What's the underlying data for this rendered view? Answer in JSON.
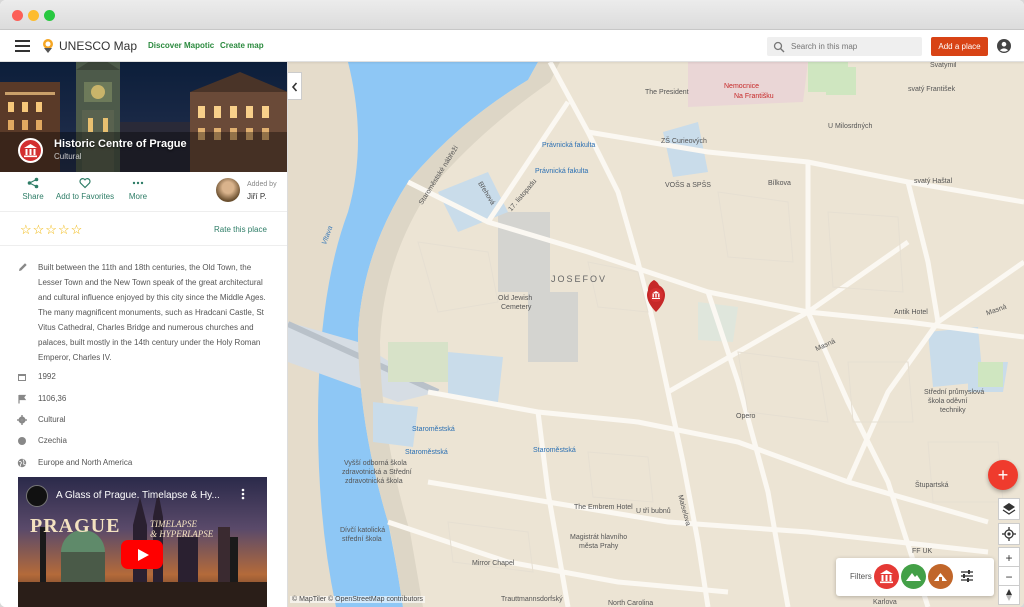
{
  "app": {
    "title": "UNESCO Map",
    "nav": [
      "Discover Mapotic",
      "Create map"
    ],
    "search_placeholder": "Search in this map",
    "add_place": "Add a place"
  },
  "place": {
    "name": "Historic Centre of Prague",
    "category": "Cultural",
    "actions": {
      "share": "Share",
      "favorite": "Add to Favorites",
      "more": "More"
    },
    "added_by_label": "Added by",
    "added_by_name": "Jiří P.",
    "rate_label": "Rate this place",
    "stars": "☆☆☆☆☆",
    "description": "Built between the 11th and 18th centuries, the Old Town, the Lesser Town and the New Town speak of the great architectural and cultural influence enjoyed by this city since the Middle Ages. The many magnificent monuments, such as Hradcani Castle, St Vitus Cathedral, Charles Bridge and numerous churches and palaces, built mostly in the 14th century under the Holy Roman Emperor, Charles IV.",
    "info": [
      {
        "icon": "calendar-icon",
        "value": "1992"
      },
      {
        "icon": "flag-icon",
        "value": "1106,36"
      },
      {
        "icon": "gear-icon",
        "value": "Cultural"
      },
      {
        "icon": "circle-icon",
        "value": "Czechia"
      },
      {
        "icon": "globe-icon",
        "value": "Europe and North America"
      }
    ],
    "video": {
      "title": "A Glass of Prague. Timelapse & Hy...",
      "thumb_title": "PRAGUE",
      "thumb_subtitle_1": "TIMELAPSE",
      "thumb_subtitle_2": "& HYPERLAPSE"
    }
  },
  "map": {
    "labels": {
      "josefov": "JOSEFOV",
      "vltava": "Vltava",
      "president": "The President",
      "nemocnice_1": "Nemocnice",
      "nemocnice_2": "Na Františku",
      "svatymil": "Svatymil",
      "frantisek": "svatý František",
      "milosrdnych": "U Milosrdných",
      "pravnicka_1": "Právnická fakulta",
      "pravnicka_2": "Právnická fakulta",
      "zs": "ZŠ Curieových",
      "voss": "VOŠS a SPŠS",
      "bilkova": "Bílkova",
      "svaty_hastal": "svatý Haštal",
      "brehova": "Břehová",
      "listopadu": "17. listopadu",
      "nabrezi": "Staroměstské nábřeží",
      "cemetery_1": "Old Jewish",
      "cemetery_2": "Cemetery",
      "antik": "Antik Hotel",
      "masna_1": "Masná",
      "masna_2": "Masná",
      "stredni_1": "Střední průmyslová",
      "stredni_2": "škola oděvní",
      "stredni_3": "techniky",
      "opero": "Opero",
      "staromestska_1": "Staroměstská",
      "staromestska_2": "Staroměstská",
      "staromestska_3": "Staroměstská",
      "vyssi_1": "Vyšší odborná škola",
      "vyssi_2": "zdravotnická a Střední",
      "vyssi_3": "zdravotnická škola",
      "embrem": "The Embrem Hotel",
      "utri": "U tří bubnů",
      "maklova": "Maiselova",
      "magistrat_1": "Magistrát hlavního",
      "magistrat_2": "města Prahy",
      "divci_1": "Dívčí katolická",
      "divci_2": "střední škola",
      "mirror": "Mirror Chapel",
      "stupartska": "Štupartská",
      "ffuk": "FF UK",
      "trautt": "Trauttmannsdorfský",
      "north_carolina": "North Carolina",
      "karlova": "Karlova"
    },
    "attribution": "© MapTiler © OpenStreetMap contributors",
    "filters_label": "Filters",
    "colors": {
      "cultural": "#e53935",
      "natural": "#43a047",
      "mixed": "#c1662a",
      "water": "#8ec7f5",
      "accent": "#d84315"
    }
  }
}
